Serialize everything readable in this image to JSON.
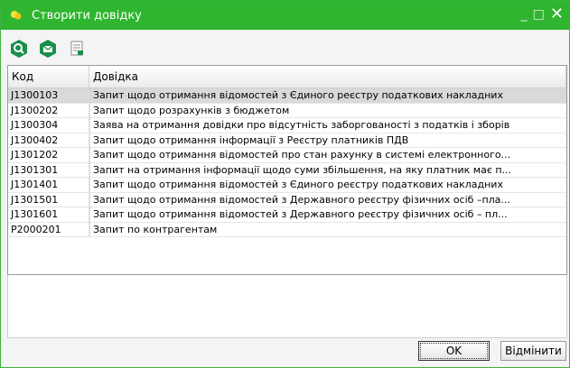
{
  "window": {
    "title": "Створити довідку",
    "colors": {
      "titlebar": "#2fb52f",
      "accent": "#1a8f4a"
    }
  },
  "toolbar": {
    "buttons": [
      {
        "icon": "search-badge-icon"
      },
      {
        "icon": "mail-badge-icon"
      },
      {
        "icon": "document-icon"
      }
    ]
  },
  "table": {
    "columns": [
      "Код",
      "Довідка"
    ],
    "rows": [
      {
        "code": "J1300103",
        "name": "Запит щодо отримання відомостей з Єдиного реєстру податкових накладних",
        "selected": true
      },
      {
        "code": "J1300202",
        "name": "Запит щодо розрахунків з бюджетом"
      },
      {
        "code": "J1300304",
        "name": "Заява на отримання довідки про відсутність заборгованості з податків і зборів"
      },
      {
        "code": "J1300402",
        "name": "Запит щодо отримання інформації з Реєстру платників ПДВ"
      },
      {
        "code": "J1301202",
        "name": "Запит щодо отримання відомостей про стан рахунку  в системі електронного..."
      },
      {
        "code": "J1301301",
        "name": "Запит на отримання інформації щодо суми збільшення, на яку платник має п..."
      },
      {
        "code": "J1301401",
        "name": "Запит щодо отримання відомостей з Єдиного реєстру податкових накладних"
      },
      {
        "code": "J1301501",
        "name": "Запит щодо отримання відомостей з Державного реєстру фізичних осіб –пла..."
      },
      {
        "code": "J1301601",
        "name": "Запит щодо отримання відомостей з Державного реєстру фізичних осіб – пл..."
      },
      {
        "code": "P2000201",
        "name": "Запит по контрагентам"
      }
    ]
  },
  "buttons": {
    "ok": "OK",
    "cancel": "Відмінити"
  }
}
